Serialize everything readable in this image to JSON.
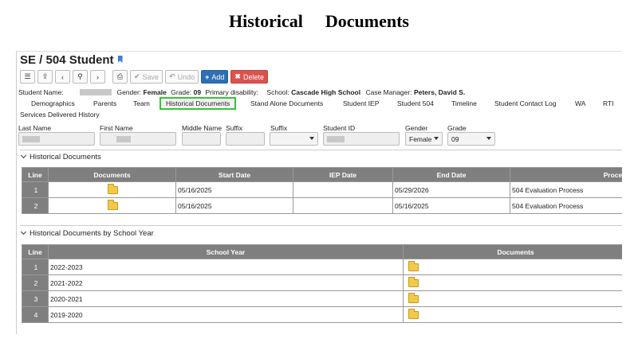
{
  "heading": {
    "word1": "Historical",
    "word2": "Documents"
  },
  "app_title": "SE / 504 Student",
  "toolbar": {
    "save_label": "Save",
    "undo_label": "Undo",
    "add_label": "Add",
    "delete_label": "Delete"
  },
  "student_info": {
    "name_label": "Student Name:",
    "gender_label": "Gender:",
    "gender_value": "Female",
    "grade_label": "Grade:",
    "grade_value": "09",
    "disability_label": "Primary disability:",
    "school_label": "School:",
    "school_value": "Cascade High School",
    "case_manager_label": "Case Manager:",
    "case_manager_value": "Peters, David S."
  },
  "tabs": [
    "Demographics",
    "Parents",
    "Team",
    "Historical Documents",
    "Stand Alone Documents",
    "Student IEP",
    "Student 504",
    "Timeline",
    "Student Contact Log",
    "WA",
    "RTI",
    "Services Delivered History"
  ],
  "fields": {
    "last_name": "Last Name",
    "first_name": "First Name",
    "middle_name": "Middle Name",
    "suffix": "Suffix",
    "suffix2": "Suffix",
    "student_id": "Student ID",
    "gender": "Gender",
    "gender_value": "Female",
    "grade": "Grade",
    "grade_value": "09"
  },
  "section1": {
    "title": "Historical Documents",
    "headers": [
      "Line",
      "Documents",
      "Start Date",
      "IEP Date",
      "End Date",
      "Proces"
    ],
    "rows": [
      {
        "line": "1",
        "start": "05/16/2025",
        "iep": "",
        "end": "05/29/2026",
        "process": "504 Evaluation Process"
      },
      {
        "line": "2",
        "start": "05/16/2025",
        "iep": "",
        "end": "05/16/2025",
        "process": "504 Evaluation Process"
      }
    ]
  },
  "section2": {
    "title": "Historical Documents by School Year",
    "headers": [
      "Line",
      "School Year",
      "Documents"
    ],
    "rows": [
      {
        "line": "1",
        "year": "2022-2023"
      },
      {
        "line": "2",
        "year": "2021-2022"
      },
      {
        "line": "3",
        "year": "2020-2021"
      },
      {
        "line": "4",
        "year": "2019-2020"
      }
    ]
  },
  "colors": {
    "active_tab_border": "#3ac23a",
    "add_button": "#2f6fb3",
    "delete_button": "#d9534f",
    "header_gray": "#7f7f7f"
  }
}
